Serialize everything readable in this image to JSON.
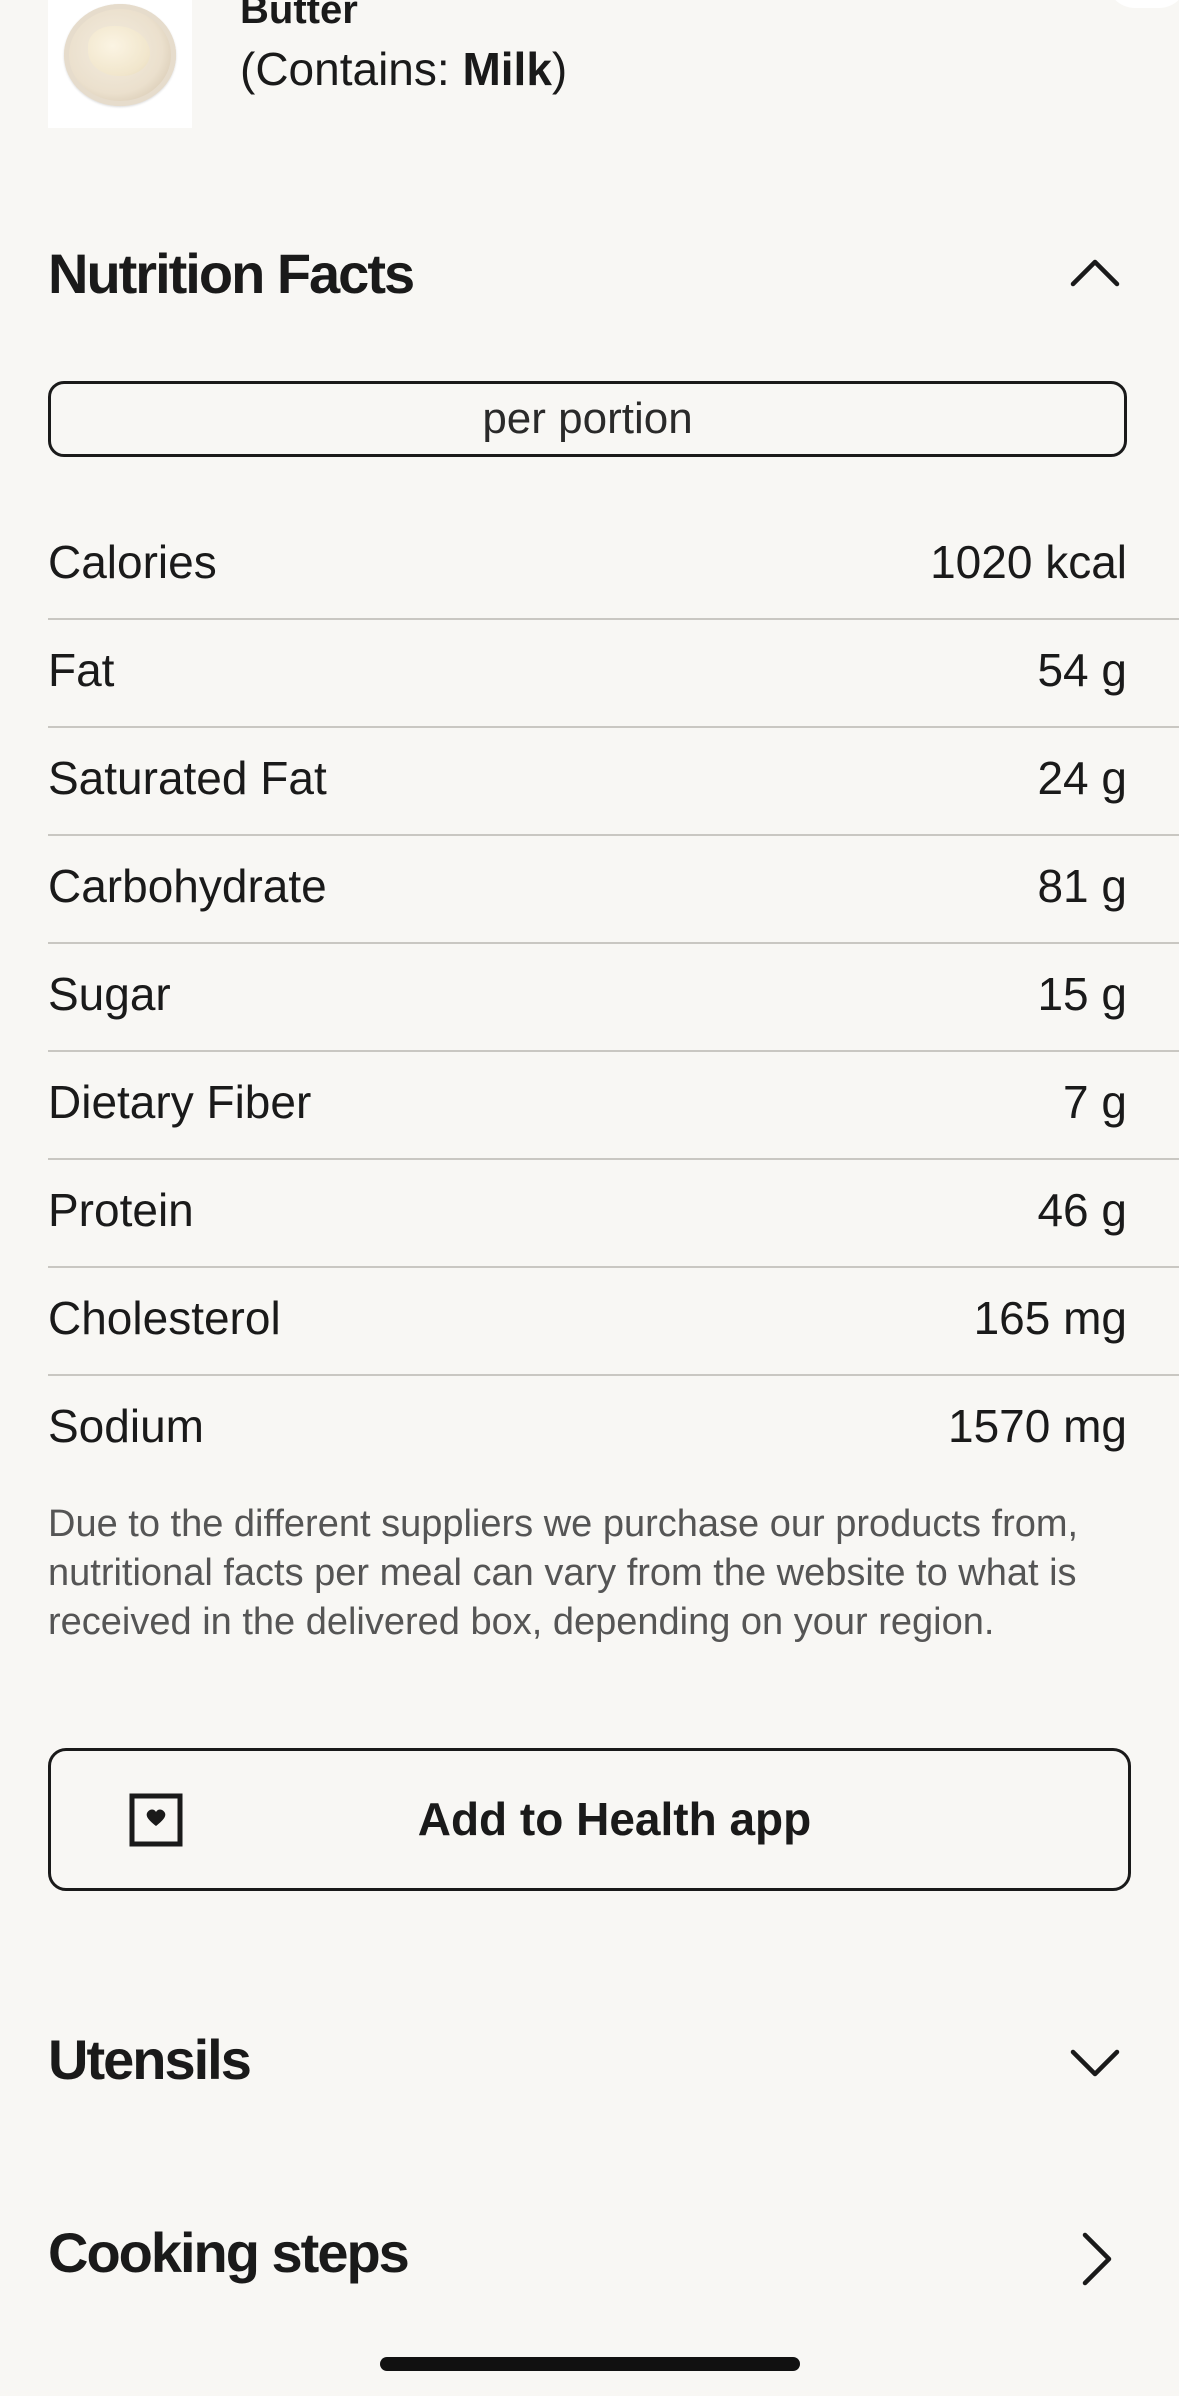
{
  "ingredient": {
    "name": "Butter",
    "allergen_prefix": "(Contains: ",
    "allergen": "Milk",
    "allergen_suffix": ")",
    "thumbnail_icon": "butter-bowl-image"
  },
  "nutrition": {
    "title": "Nutrition Facts",
    "toggle_icon": "chevron-up-icon",
    "portion_label": "per portion",
    "rows": [
      {
        "label": "Calories",
        "value": "1020 kcal"
      },
      {
        "label": "Fat",
        "value": "54 g"
      },
      {
        "label": "Saturated Fat",
        "value": "24 g"
      },
      {
        "label": "Carbohydrate",
        "value": "81 g"
      },
      {
        "label": "Sugar",
        "value": "15 g"
      },
      {
        "label": "Dietary Fiber",
        "value": "7 g"
      },
      {
        "label": "Protein",
        "value": "46 g"
      },
      {
        "label": "Cholesterol",
        "value": "165 mg"
      },
      {
        "label": "Sodium",
        "value": "1570 mg"
      }
    ],
    "disclaimer": "Due to the different suppliers we purchase our products from, nutritional facts per meal can vary from the website to what is received in the delivered box, depending on your region.",
    "health_button_label": "Add to Health app",
    "health_icon": "health-heart-icon"
  },
  "utensils": {
    "title": "Utensils",
    "toggle_icon": "chevron-down-icon"
  },
  "cooking_steps": {
    "title": "Cooking steps",
    "toggle_icon": "chevron-right-icon"
  },
  "colors": {
    "background": "#f8f7f4",
    "text": "#1a1a1a",
    "divider": "#c9c7c2",
    "muted_text": "#555555"
  }
}
